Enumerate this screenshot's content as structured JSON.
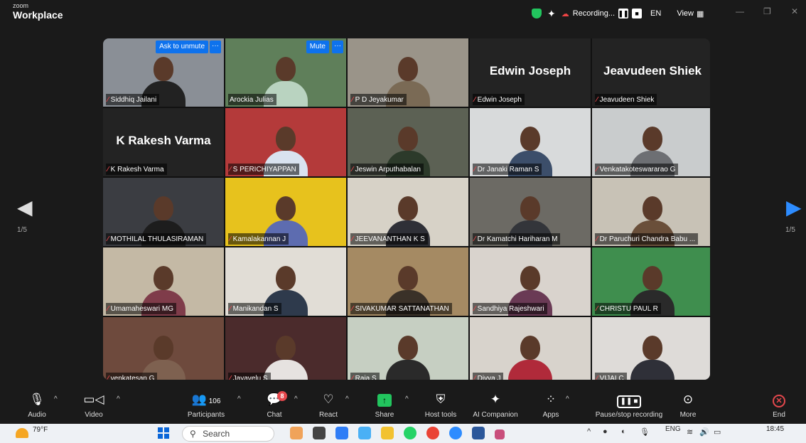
{
  "window": {
    "brand_small": "zoom",
    "brand_big": "Workplace",
    "recording_label": "Recording...",
    "language": "EN",
    "view_label": "View"
  },
  "pager": {
    "left": "1/5",
    "right": "1/5"
  },
  "tile_controls": {
    "ask_to_unmute": "Ask to unmute",
    "mute": "Mute",
    "more": "···"
  },
  "tiles": [
    {
      "name": "Siddhiq Jailani",
      "type": "video",
      "bg": "#8a8f96",
      "shirt": "#222"
    },
    {
      "name": "Arockia Julias",
      "type": "video",
      "bg": "#5f7f5a",
      "shirt": "#b9d3c0",
      "active": true
    },
    {
      "name": "P D Jeyakumar",
      "type": "video",
      "bg": "#9a9489",
      "shirt": "#7a6a55"
    },
    {
      "name": "Edwin Joseph",
      "type": "namecard",
      "display": "Edwin Joseph"
    },
    {
      "name": "Jeavudeen Shiek",
      "type": "namecard",
      "display": "Jeavudeen Shiek"
    },
    {
      "name": "K Rakesh Varma",
      "type": "namecard",
      "display": "K Rakesh Varma"
    },
    {
      "name": "S PERICHIYAPPAN",
      "type": "video",
      "bg": "#b43a3a",
      "shirt": "#d9e2f0"
    },
    {
      "name": "Jeswin Arputhabalan",
      "type": "video",
      "bg": "#5c6154",
      "shirt": "#2c3a2a"
    },
    {
      "name": "Dr Janaki Raman S",
      "type": "video",
      "bg": "#d8dadb",
      "shirt": "#3c4e6a"
    },
    {
      "name": "Venkatakoteswararao G",
      "type": "video",
      "bg": "#c9cccd",
      "shirt": "#6d6f73"
    },
    {
      "name": "MOTHILAL THULASIRAMAN",
      "type": "video",
      "bg": "#3b3d42",
      "shirt": "#1d1d1d"
    },
    {
      "name": "Kamalakannan J",
      "type": "video",
      "bg": "#e7c21d",
      "shirt": "#5d6cb0"
    },
    {
      "name": "JEEVANANTHAN K S",
      "type": "video",
      "bg": "#d7d2c7",
      "shirt": "#2f3037"
    },
    {
      "name": "Dr Kamatchi Hariharan M",
      "type": "video",
      "bg": "#6c6a64",
      "shirt": "#33353a"
    },
    {
      "name": "Dr Paruchuri Chandra Babu ...",
      "type": "video",
      "bg": "#c8c2b6",
      "shirt": "#6a4f3a"
    },
    {
      "name": "Umamaheswari MG",
      "type": "video",
      "bg": "#c4b9a5",
      "shirt": "#7f3c4a"
    },
    {
      "name": "Manikandan S",
      "type": "video",
      "bg": "#e1ddd6",
      "shirt": "#2e3a4c"
    },
    {
      "name": "SIVAKUMAR SATTANATHAN",
      "type": "video",
      "bg": "#a58a63",
      "shirt": "#3a3128"
    },
    {
      "name": "Sandhiya Rajeshwari",
      "type": "video",
      "bg": "#d9d3cd",
      "shirt": "#6a3a55"
    },
    {
      "name": "CHRISTU PAUL R",
      "type": "video",
      "bg": "#3f8e4e",
      "shirt": "#2a2a2a"
    },
    {
      "name": "venkatesan G",
      "type": "video",
      "bg": "#6e4a3d",
      "shirt": "#7e6150"
    },
    {
      "name": "Jayavelu S",
      "type": "video",
      "bg": "#4b2b2c",
      "shirt": "#e6e2e0"
    },
    {
      "name": "Raja S",
      "type": "video",
      "bg": "#c6cfc2",
      "shirt": "#2a2a2a"
    },
    {
      "name": "Divya J",
      "type": "video",
      "bg": "#d8d3cc",
      "shirt": "#b02a3a"
    },
    {
      "name": "VIJAI C",
      "type": "video",
      "bg": "#dedbd8",
      "shirt": "#2f3038"
    }
  ],
  "toolbar": {
    "audio": "Audio",
    "video": "Video",
    "participants": "Participants",
    "participants_count": "106",
    "chat": "Chat",
    "chat_badge": "8",
    "react": "React",
    "share": "Share",
    "host_tools": "Host tools",
    "ai_companion": "AI Companion",
    "apps": "Apps",
    "pause_stop_recording": "Pause/stop recording",
    "more": "More",
    "end": "End"
  },
  "taskbar": {
    "temperature": "79°F",
    "search_placeholder": "Search",
    "lang": "ENG",
    "time": "18:45"
  },
  "colors": {
    "accent_blue": "#0e72ed",
    "active_speaker": "#5ee87c",
    "share_green": "#22c55e",
    "end_red": "#e5484d"
  }
}
